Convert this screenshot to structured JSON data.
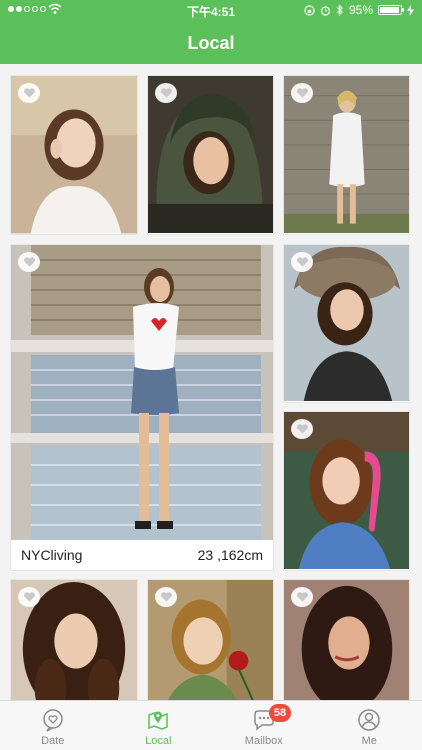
{
  "status_bar": {
    "time": "下午4:51",
    "battery_text": "95%",
    "battery_level": 0.95,
    "signal_bars_filled": 2,
    "signal_bars_total": 5
  },
  "header": {
    "title": "Local"
  },
  "featured_profile": {
    "username": "NYCliving",
    "details": "23 ,162cm"
  },
  "tabs": [
    {
      "label": "Date",
      "icon": "heart-chat-icon",
      "active": false
    },
    {
      "label": "Local",
      "icon": "map-pin-icon",
      "active": true
    },
    {
      "label": "Mailbox",
      "icon": "chat-bubble-icon",
      "active": false,
      "badge": "58"
    },
    {
      "label": "Me",
      "icon": "user-icon",
      "active": false
    }
  ],
  "colors": {
    "accent": "#5cc05a",
    "badge": "#f04a3e"
  }
}
